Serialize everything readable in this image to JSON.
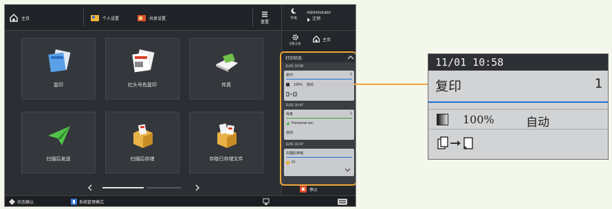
{
  "topbar": {
    "home_label": "主页",
    "personal_label": "个人设置",
    "shared_label": "共享设置",
    "reset_label": "重置",
    "sleep_label": "节电",
    "user_name": "Administrator",
    "logout_label": "注销"
  },
  "side": {
    "settings_label": "设置/注册",
    "home_label": "主页",
    "stop_label": "停止"
  },
  "tiles": [
    {
      "label": "复印"
    },
    {
      "label": "红头号色复印"
    },
    {
      "label": "传真"
    },
    {
      "label": "扫描后发送"
    },
    {
      "label": "扫描后存储"
    },
    {
      "label": "存取已存储文件"
    }
  ],
  "monitor": {
    "title": "打印状态",
    "jobs": [
      {
        "time": "11/01 10:58",
        "name": "复印",
        "count": "1",
        "ratio": "100%",
        "mode": "自动"
      },
      {
        "time": "11/01 10:47",
        "name": "传真",
        "count": "1",
        "recipient": "Personnel sec.",
        "mode": "自动"
      },
      {
        "time": "11/01 10:47",
        "name": "扫描后存储",
        "detail": "01"
      }
    ]
  },
  "statusbar": {
    "status_label": "状态确认",
    "mode_label": "系统管理模式"
  },
  "zoom": {
    "time": "11/01 10:58",
    "job_name": "复印",
    "count": "1",
    "ratio": "100%",
    "mode": "自动"
  }
}
